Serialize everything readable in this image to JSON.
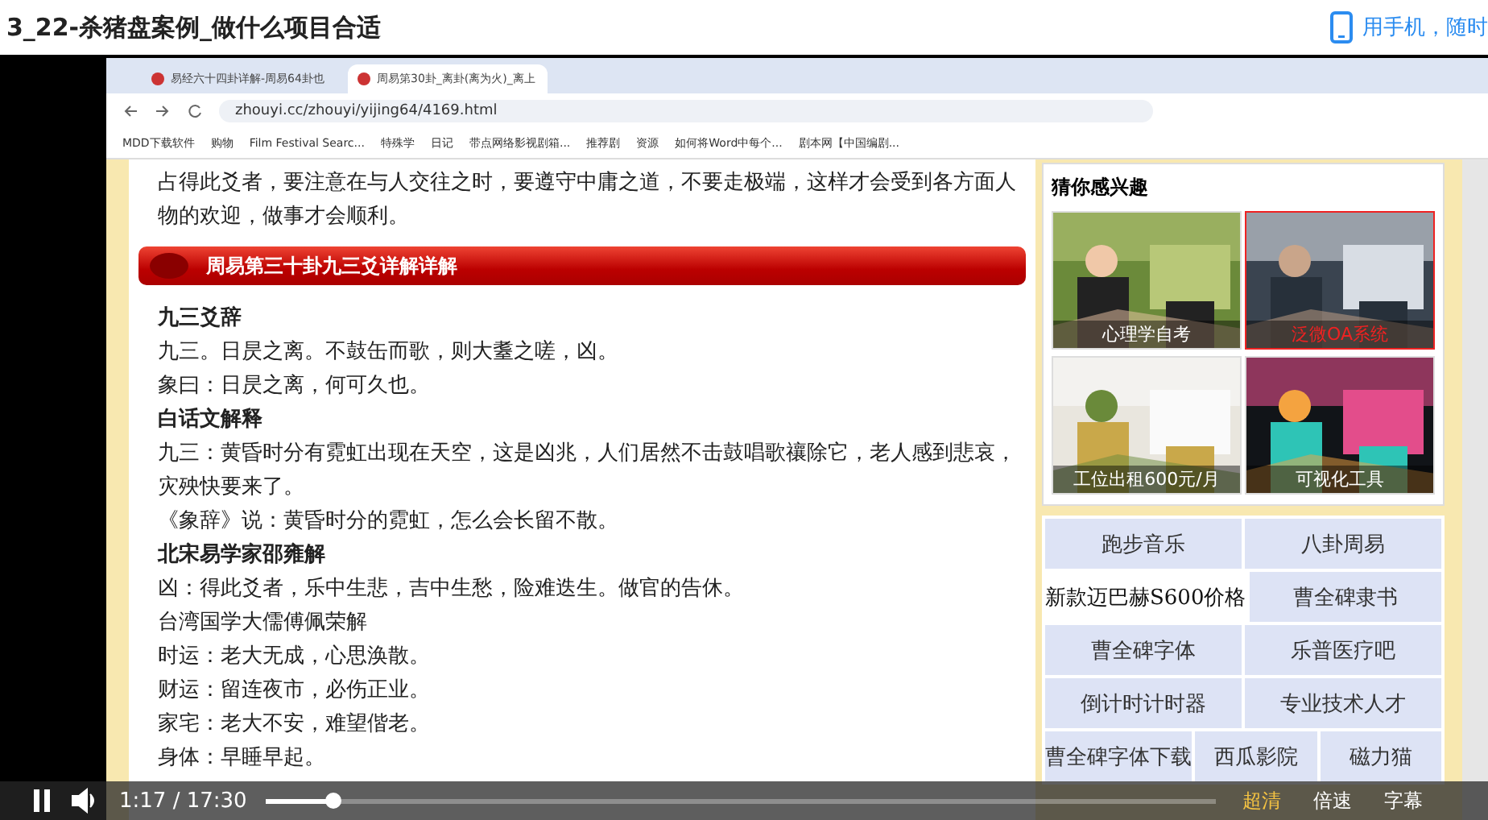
{
  "page_title": "3_22-杀猪盘案例_做什么项目合适",
  "phone_link": "用手机，随时",
  "browser": {
    "tabs": [
      {
        "label": "易经六十四卦详解-周易64卦也",
        "selected": false
      },
      {
        "label": "周易第30卦_离卦(离为火)_离上",
        "selected": true
      }
    ],
    "address": "zhouyi.cc/zhouyi/yijing64/4169.html",
    "bookmarks": [
      "MDD下载软件",
      "购物",
      "Film Festival Searc...",
      "特殊学",
      "日记",
      "带点网络影视剧箱...",
      "推荐剧",
      "资源",
      "如何将Word中每个...",
      "剧本网【中国编剧..."
    ]
  },
  "article": {
    "blocks": [
      {
        "kind": "text",
        "text": "占得此爻者，要注意在与人交往之时，要遵守中庸之道，不要走极端，这样才会受到各方面人物的欢迎，做事才会顺利。"
      },
      {
        "kind": "banner",
        "text": "周易第三十卦九三爻详解详解"
      },
      {
        "kind": "heading",
        "text": "九三爻辞"
      },
      {
        "kind": "text",
        "text": "九三。日昃之离。不鼓缶而歌，则大耋之嗟，凶。"
      },
      {
        "kind": "text",
        "text": "象曰：日昃之离，何可久也。"
      },
      {
        "kind": "heading",
        "text": "白话文解释"
      },
      {
        "kind": "text",
        "text": "九三：黄昏时分有霓虹出现在天空，这是凶兆，人们居然不击鼓唱歌禳除它，老人感到悲哀，灾殃快要来了。"
      },
      {
        "kind": "text",
        "text": "《象辞》说：黄昏时分的霓虹，怎么会长留不散。"
      },
      {
        "kind": "heading",
        "text": "北宋易学家邵雍解"
      },
      {
        "kind": "text",
        "text": "凶：得此爻者，乐中生悲，吉中生愁，险难迭生。做官的告休。"
      },
      {
        "kind": "text",
        "text": "台湾国学大儒傅佩荣解"
      },
      {
        "kind": "text",
        "text": "时运：老大无成，心思涣散。"
      },
      {
        "kind": "text",
        "text": "财运：留连夜市，必伤正业。"
      },
      {
        "kind": "text",
        "text": "家宅：老大不安，难望偕老。"
      },
      {
        "kind": "text",
        "text": "身体：早睡早起。"
      }
    ]
  },
  "sidebar": {
    "title": "猜你感兴趣",
    "tiles": [
      {
        "caption": "心理学自考",
        "highlighted": false
      },
      {
        "caption": "泛微OA系统",
        "highlighted": true
      },
      {
        "caption": "工位出租600元/月",
        "highlighted": false
      },
      {
        "caption": "可视化工具",
        "highlighted": false
      }
    ],
    "link_rows": [
      [
        {
          "label": "跑步音乐",
          "highlighted": false
        },
        {
          "label": "八卦周易",
          "highlighted": false
        }
      ],
      [
        {
          "label": "新款迈巴赫S600价格",
          "highlighted": true
        },
        {
          "label": "曹全碑隶书",
          "highlighted": false
        }
      ],
      [
        {
          "label": "曹全碑字体",
          "highlighted": false
        },
        {
          "label": "乐普医疗吧",
          "highlighted": false
        }
      ],
      [
        {
          "label": "倒计时计时器",
          "highlighted": false
        },
        {
          "label": "专业技术人才",
          "highlighted": false
        }
      ],
      [
        {
          "label": "曹全碑字体下载",
          "highlighted": false
        },
        {
          "label": "西瓜影院",
          "highlighted": false
        },
        {
          "label": "磁力猫",
          "highlighted": false
        }
      ]
    ]
  },
  "player": {
    "playing": true,
    "time": "1:17 / 17:30",
    "level": 0.07,
    "quality": "超清",
    "speed": "倍速",
    "subtitles": "字幕"
  }
}
